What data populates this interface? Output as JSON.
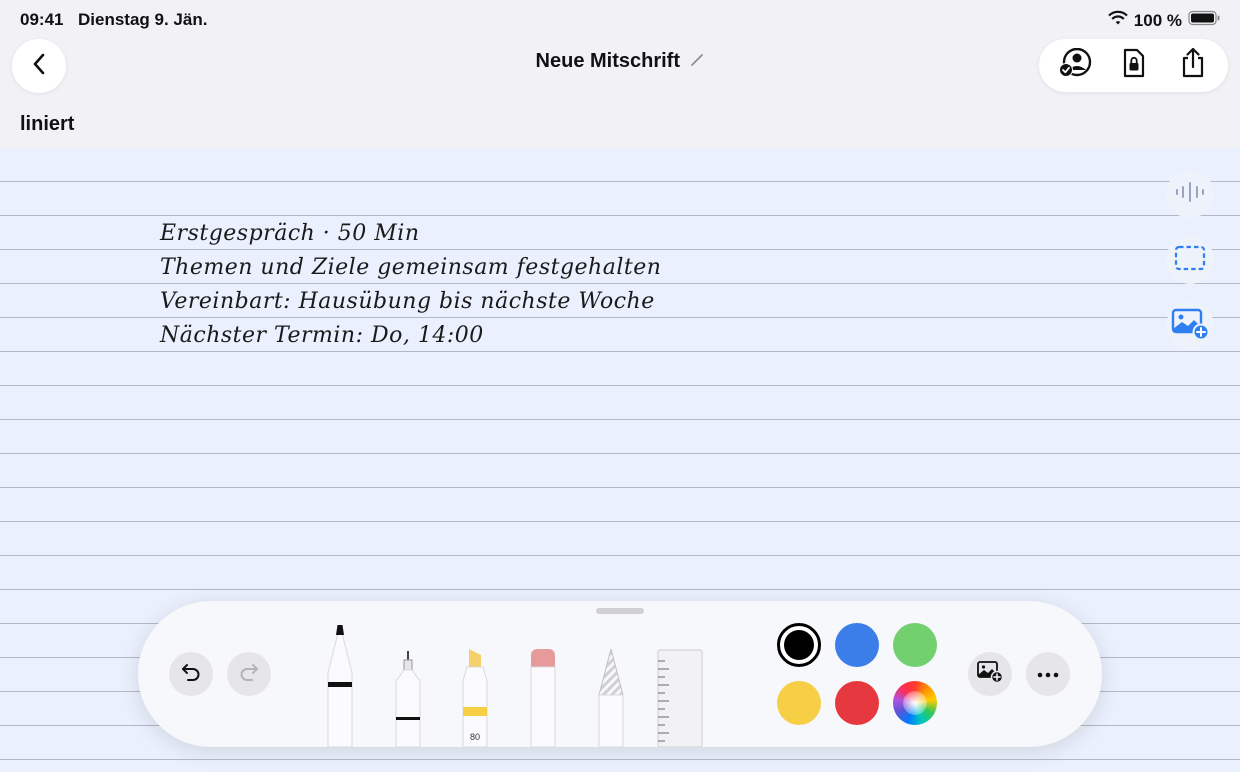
{
  "status_bar": {
    "time": "09:41",
    "date": "Dienstag 9. Jän.",
    "battery": "100 %"
  },
  "header": {
    "title": "Neue Mitschrift",
    "icons": [
      "back-icon",
      "edit-pencil-icon",
      "collaborate-icon",
      "locked-document-icon",
      "share-icon"
    ]
  },
  "paper": {
    "style_label": "liniert",
    "lines": [
      "Erstgespräch · 50 Min",
      "Themen und Ziele gemeinsam festgehalten",
      "Vereinbart: Hausübung bis nächste Woche",
      "Nächster Termin: Do, 14:00"
    ]
  },
  "side_tools": [
    "audio-waveform-icon",
    "selection-rectangle-icon",
    "add-image-icon"
  ],
  "toolbar": {
    "tools": [
      "pen",
      "fineliner",
      "marker",
      "eraser",
      "pencil",
      "ruler"
    ],
    "marker_label": "80",
    "colors": {
      "black": "#000000",
      "blue": "#3b7de9",
      "green": "#72d06f",
      "yellow": "#f6cf47",
      "red": "#e6393f"
    },
    "selected_color": "black"
  },
  "colors": {
    "accent": "#2f7ff0",
    "paper_background": "#eaf0fd",
    "rule_line": "#b4b8c6"
  }
}
